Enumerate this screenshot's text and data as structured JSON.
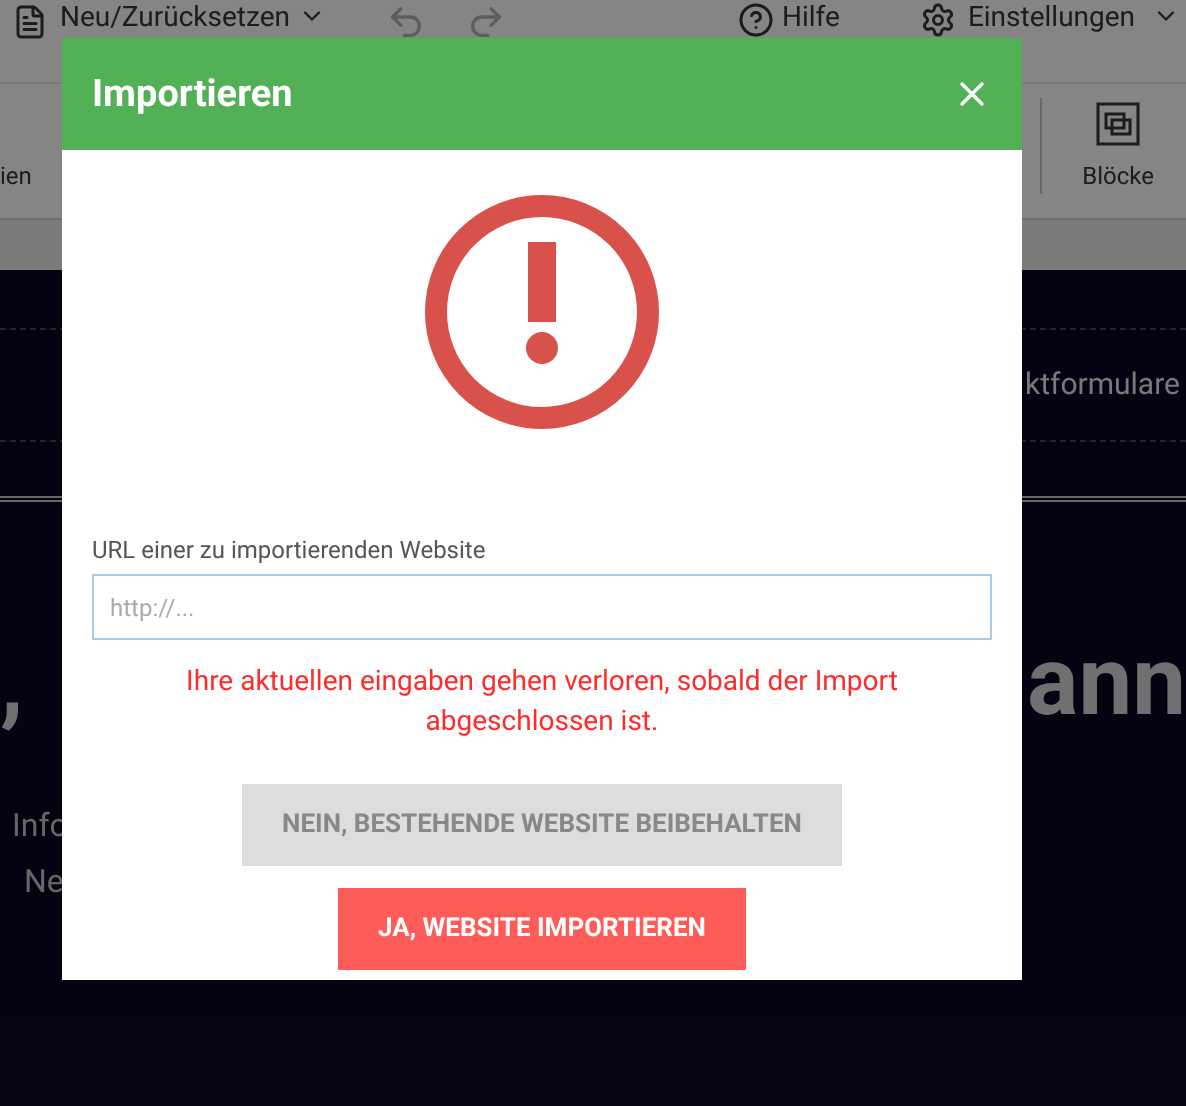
{
  "toolbar": {
    "new_reset": "Neu/Zurücksetzen",
    "help": "Hilfe",
    "settings": "Einstellungen"
  },
  "ribbon": {
    "left_label": "ien",
    "blocks": "Blöcke"
  },
  "page": {
    "nav_text": "ktformulare",
    "hero_left": ",",
    "hero_right": "ann",
    "info": "Info",
    "short": "Ne"
  },
  "dialog": {
    "title": "Importieren",
    "url_label": "URL einer zu importierenden Website",
    "url_field": {
      "placeholder": "http://..."
    },
    "warning": "Ihre aktuellen eingaben gehen verloren, sobald der Import abgeschlossen ist.",
    "buttons": [
      {
        "label": "NEIN, BESTEHENDE WEBSITE BEIBEHALTEN",
        "kind": "secondary"
      },
      {
        "label": "JA, WEBSITE IMPORTIEREN",
        "kind": "primary"
      }
    ]
  }
}
